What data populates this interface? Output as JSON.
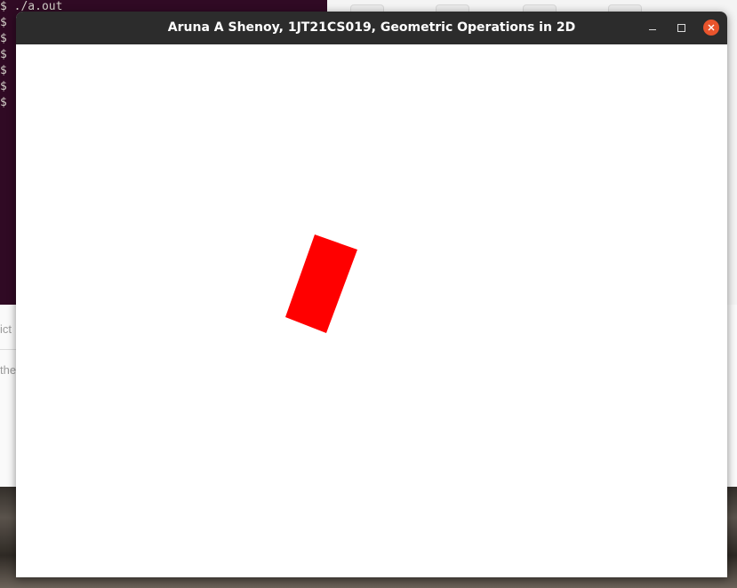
{
  "terminal": {
    "lines": [
      "$ ./a.out",
      "$",
      "$",
      "$",
      "$",
      "$",
      "$"
    ]
  },
  "background_window": {
    "partial_text_1": "ict",
    "partial_text_2": "the"
  },
  "window": {
    "title": "Aruna A Shenoy, 1JT21CS019, Geometric Operations in 2D",
    "controls": {
      "minimize": "minimize-icon",
      "maximize": "maximize-icon",
      "close": "close-icon"
    },
    "close_color": "#e9542c"
  },
  "canvas": {
    "background": "#ffffff",
    "shape": {
      "type": "rotated-rectangle",
      "fill": "#ff0000"
    }
  }
}
